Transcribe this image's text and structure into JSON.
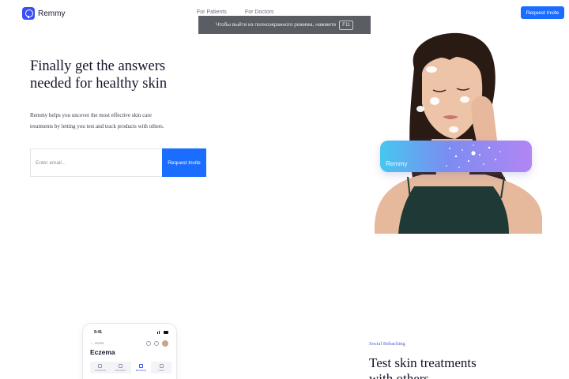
{
  "header": {
    "logo_text": "Remmy",
    "nav": [
      "For Patients",
      "For Doctors"
    ],
    "cta_label": "Request Invite"
  },
  "fullscreen_notice": {
    "text": "Чтобы выйти из полноэкранного режима, нажмите",
    "key": "F11"
  },
  "hero": {
    "title_line1": "Finally get the answers",
    "title_line2": "needed for healthy skin",
    "description": "Remmy helps you uncover the most effective skin care treatments by letting you test and track products with others.",
    "email_placeholder": "Enter email...",
    "button_label": "Request Invite",
    "card_label": "Remmy"
  },
  "phone": {
    "time": "9:41",
    "back_label": "Home",
    "title": "Eczema",
    "tabs": [
      "Treatments",
      "Reminders",
      "Behacking",
      "Learn"
    ],
    "active_tab": 2
  },
  "section2": {
    "eyebrow": "Social Behacking",
    "title_line1": "Test skin treatments",
    "title_line2": "with others"
  },
  "colors": {
    "accent": "#1a6dff",
    "brand": "#3b4ff5",
    "heading": "#13142b",
    "banner_bg": "#5a5d63"
  }
}
